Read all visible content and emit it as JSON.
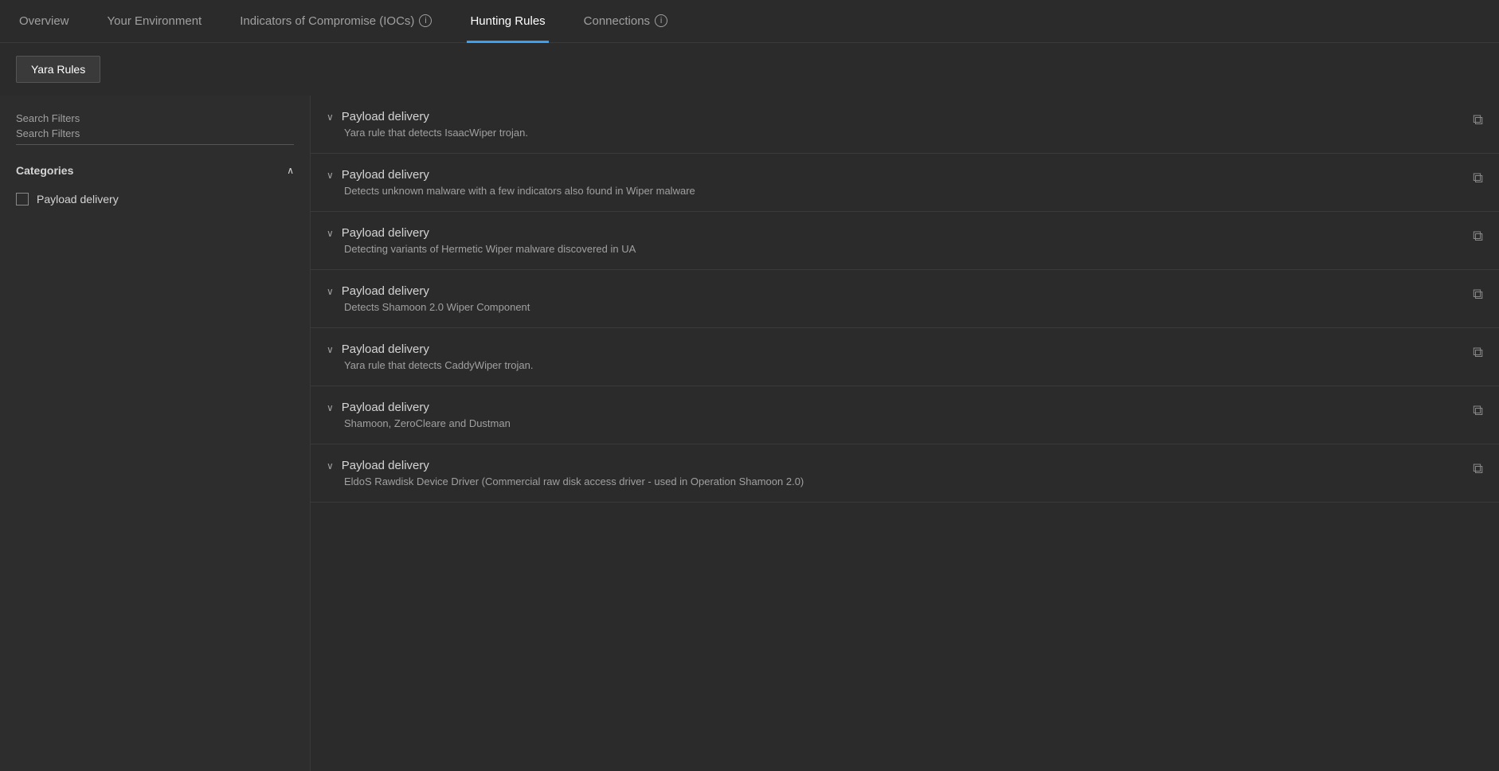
{
  "nav": {
    "tabs": [
      {
        "id": "overview",
        "label": "Overview",
        "active": false
      },
      {
        "id": "your-environment",
        "label": "Your Environment",
        "active": false
      },
      {
        "id": "iocs",
        "label": "Indicators of Compromise (IOCs)",
        "active": false,
        "hasInfo": true
      },
      {
        "id": "hunting-rules",
        "label": "Hunting Rules",
        "active": true
      },
      {
        "id": "connections",
        "label": "Connections",
        "active": false,
        "hasInfo": true
      }
    ]
  },
  "subheader": {
    "yara_btn_label": "Yara Rules"
  },
  "sidebar": {
    "search_placeholder": "Search Filters",
    "categories_label": "Categories",
    "categories": [
      {
        "id": "payload-delivery",
        "label": "Payload delivery",
        "checked": false
      }
    ]
  },
  "rules": [
    {
      "id": 1,
      "category": "Payload delivery",
      "description": "Yara rule that detects IsaacWiper trojan."
    },
    {
      "id": 2,
      "category": "Payload delivery",
      "description": "Detects unknown malware with a few indicators also found in Wiper malware"
    },
    {
      "id": 3,
      "category": "Payload delivery",
      "description": "Detecting variants of Hermetic Wiper malware discovered in UA"
    },
    {
      "id": 4,
      "category": "Payload delivery",
      "description": "Detects Shamoon 2.0 Wiper Component"
    },
    {
      "id": 5,
      "category": "Payload delivery",
      "description": "Yara rule that detects CaddyWiper trojan."
    },
    {
      "id": 6,
      "category": "Payload delivery",
      "description": "Shamoon, ZeroCleare and Dustman"
    },
    {
      "id": 7,
      "category": "Payload delivery",
      "description": "EldoS Rawdisk Device Driver (Commercial raw disk access driver - used in Operation Shamoon 2.0)"
    }
  ],
  "icons": {
    "chevron_up": "∧",
    "chevron_down": "∨",
    "copy": "⧉",
    "info": "i"
  }
}
